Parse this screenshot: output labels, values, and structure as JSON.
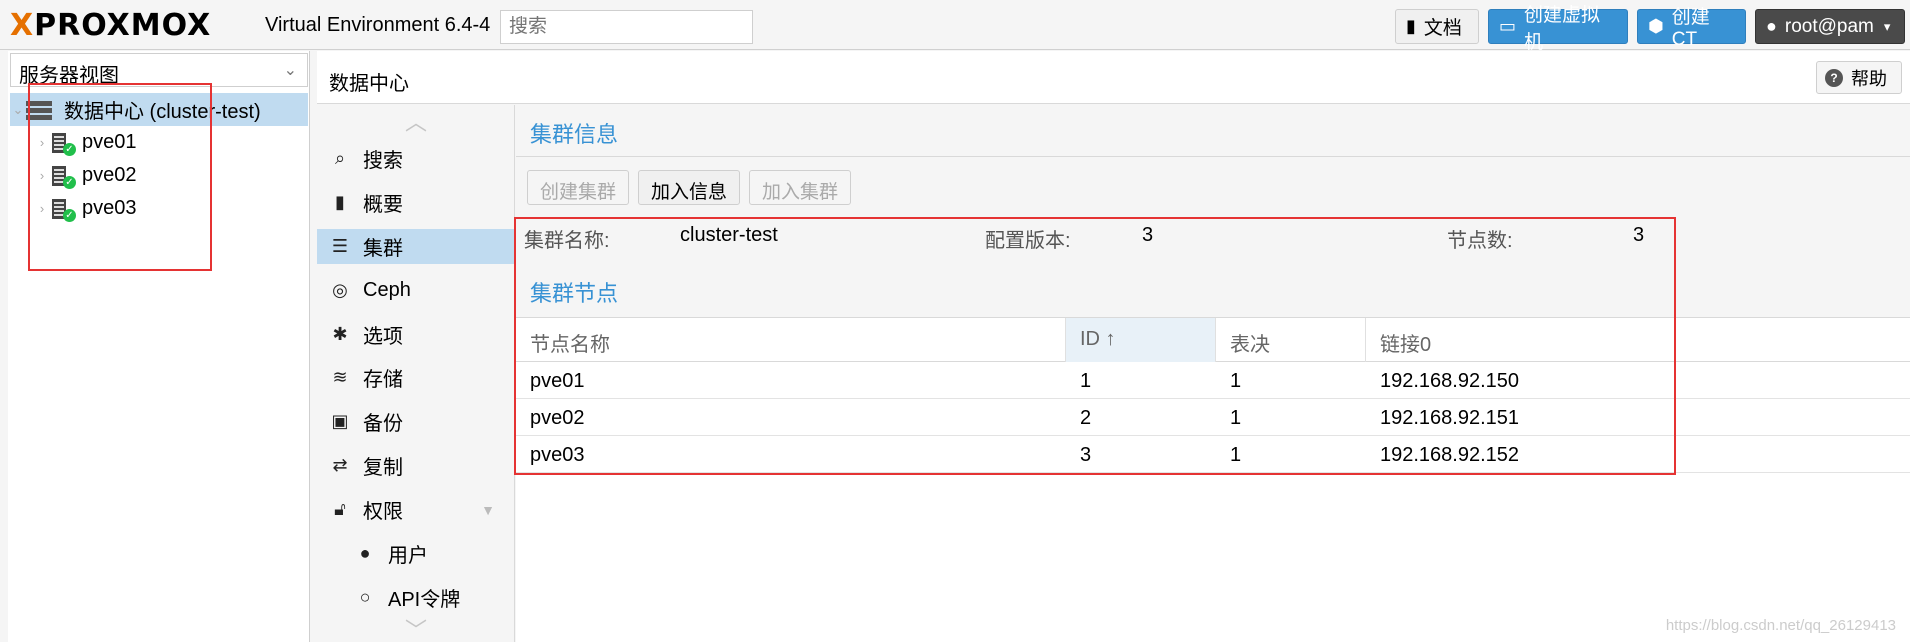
{
  "header": {
    "logo_text": "PROXMOX",
    "version": "Virtual Environment 6.4-4",
    "search_placeholder": "搜索",
    "docs_label": "文档",
    "create_vm_label": "创建虚拟机",
    "create_ct_label": "创建CT",
    "user_label": "root@pam"
  },
  "tree": {
    "view_label": "服务器视图",
    "datacenter_label": "数据中心 (cluster-test)",
    "nodes": [
      "pve01",
      "pve02",
      "pve03"
    ]
  },
  "main": {
    "title": "数据中心",
    "help_label": "帮助"
  },
  "nav": {
    "items": [
      {
        "label": "搜索",
        "icon": "search-icon"
      },
      {
        "label": "概要",
        "icon": "book-icon"
      },
      {
        "label": "集群",
        "icon": "server-icon"
      },
      {
        "label": "Ceph",
        "icon": "ceph-icon"
      },
      {
        "label": "选项",
        "icon": "gear-icon"
      },
      {
        "label": "存储",
        "icon": "database-icon"
      },
      {
        "label": "备份",
        "icon": "floppy-icon"
      },
      {
        "label": "复制",
        "icon": "retweet-icon"
      },
      {
        "label": "权限",
        "icon": "unlock-icon"
      },
      {
        "label": "用户",
        "icon": "user-icon"
      },
      {
        "label": "API令牌",
        "icon": "user-outline-icon"
      }
    ]
  },
  "cluster": {
    "info_title": "集群信息",
    "create_cluster": "创建集群",
    "join_info": "加入信息",
    "join_cluster": "加入集群",
    "name_label": "集群名称:",
    "name_value": "cluster-test",
    "config_version_label": "配置版本:",
    "config_version_value": "3",
    "node_count_label": "节点数:",
    "node_count_value": "3",
    "nodes_title": "集群节点",
    "columns": [
      "节点名称",
      "ID ↑",
      "表决",
      "链接0"
    ],
    "rows": [
      [
        "pve01",
        "1",
        "1",
        "192.168.92.150"
      ],
      [
        "pve02",
        "2",
        "1",
        "192.168.92.151"
      ],
      [
        "pve03",
        "3",
        "1",
        "192.168.92.152"
      ]
    ]
  },
  "watermark": "https://blog.csdn.net/qq_26129413"
}
